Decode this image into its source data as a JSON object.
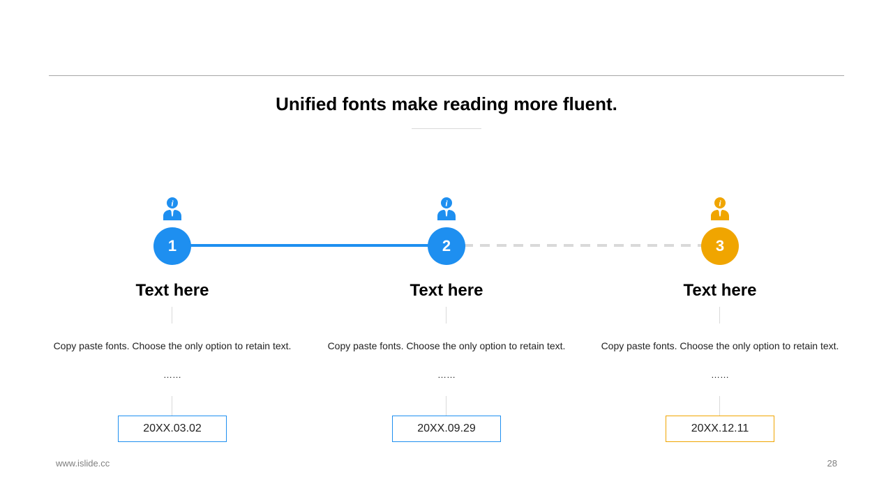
{
  "slide": {
    "title": "Unified fonts make reading more fluent.",
    "footer_url": "www.islide.cc",
    "page_number": "28"
  },
  "steps": [
    {
      "number": "1",
      "heading": "Text here",
      "description": "Copy paste fonts. Choose the only option to retain text.",
      "ellipsis": "……",
      "date": "20XX.03.02",
      "color": "#1E8FF0",
      "icon": "user-info-icon"
    },
    {
      "number": "2",
      "heading": "Text here",
      "description": "Copy paste fonts. Choose the only option to retain text.",
      "ellipsis": "……",
      "date": "20XX.09.29",
      "color": "#1E8FF0",
      "icon": "user-info-icon"
    },
    {
      "number": "3",
      "heading": "Text here",
      "description": "Copy paste fonts. Choose the only option to retain text.",
      "ellipsis": "……",
      "date": "20XX.12.11",
      "color": "#F0A500",
      "icon": "user-info-icon"
    }
  ],
  "colors": {
    "completed_connector": "#1E8FF0",
    "pending_connector": "#D9D9D9"
  }
}
